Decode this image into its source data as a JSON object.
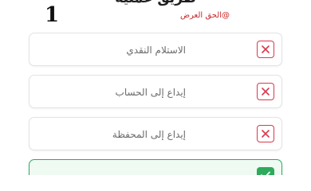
{
  "header": {
    "title_partial": "طريق عملية",
    "step_number": "1",
    "watermark": "@الحق العرض"
  },
  "options": [
    {
      "label": "الاستلام النقدي",
      "state": "unchecked",
      "mark_icon": "close-icon"
    },
    {
      "label": "إيداع إلى الحساب",
      "state": "unchecked",
      "mark_icon": "close-icon"
    },
    {
      "label": "إيداع إلى المحفظة",
      "state": "unchecked",
      "mark_icon": "close-icon"
    },
    {
      "label": "",
      "state": "selected",
      "mark_icon": "check-icon"
    }
  ],
  "colors": {
    "unchecked_mark": "#d8394f",
    "selected_border": "#27ae60",
    "selected_fill": "#eefaf2",
    "watermark": "#c62828"
  }
}
